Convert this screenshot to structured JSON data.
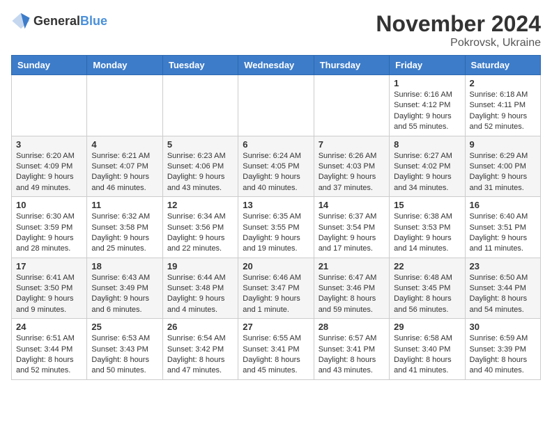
{
  "header": {
    "logo_general": "General",
    "logo_blue": "Blue",
    "month_title": "November 2024",
    "location": "Pokrovsk, Ukraine"
  },
  "weekdays": [
    "Sunday",
    "Monday",
    "Tuesday",
    "Wednesday",
    "Thursday",
    "Friday",
    "Saturday"
  ],
  "weeks": [
    [
      {
        "day": "",
        "sunrise": "",
        "sunset": "",
        "daylight": ""
      },
      {
        "day": "",
        "sunrise": "",
        "sunset": "",
        "daylight": ""
      },
      {
        "day": "",
        "sunrise": "",
        "sunset": "",
        "daylight": ""
      },
      {
        "day": "",
        "sunrise": "",
        "sunset": "",
        "daylight": ""
      },
      {
        "day": "",
        "sunrise": "",
        "sunset": "",
        "daylight": ""
      },
      {
        "day": "1",
        "sunrise": "Sunrise: 6:16 AM",
        "sunset": "Sunset: 4:12 PM",
        "daylight": "Daylight: 9 hours and 55 minutes."
      },
      {
        "day": "2",
        "sunrise": "Sunrise: 6:18 AM",
        "sunset": "Sunset: 4:11 PM",
        "daylight": "Daylight: 9 hours and 52 minutes."
      }
    ],
    [
      {
        "day": "3",
        "sunrise": "Sunrise: 6:20 AM",
        "sunset": "Sunset: 4:09 PM",
        "daylight": "Daylight: 9 hours and 49 minutes."
      },
      {
        "day": "4",
        "sunrise": "Sunrise: 6:21 AM",
        "sunset": "Sunset: 4:07 PM",
        "daylight": "Daylight: 9 hours and 46 minutes."
      },
      {
        "day": "5",
        "sunrise": "Sunrise: 6:23 AM",
        "sunset": "Sunset: 4:06 PM",
        "daylight": "Daylight: 9 hours and 43 minutes."
      },
      {
        "day": "6",
        "sunrise": "Sunrise: 6:24 AM",
        "sunset": "Sunset: 4:05 PM",
        "daylight": "Daylight: 9 hours and 40 minutes."
      },
      {
        "day": "7",
        "sunrise": "Sunrise: 6:26 AM",
        "sunset": "Sunset: 4:03 PM",
        "daylight": "Daylight: 9 hours and 37 minutes."
      },
      {
        "day": "8",
        "sunrise": "Sunrise: 6:27 AM",
        "sunset": "Sunset: 4:02 PM",
        "daylight": "Daylight: 9 hours and 34 minutes."
      },
      {
        "day": "9",
        "sunrise": "Sunrise: 6:29 AM",
        "sunset": "Sunset: 4:00 PM",
        "daylight": "Daylight: 9 hours and 31 minutes."
      }
    ],
    [
      {
        "day": "10",
        "sunrise": "Sunrise: 6:30 AM",
        "sunset": "Sunset: 3:59 PM",
        "daylight": "Daylight: 9 hours and 28 minutes."
      },
      {
        "day": "11",
        "sunrise": "Sunrise: 6:32 AM",
        "sunset": "Sunset: 3:58 PM",
        "daylight": "Daylight: 9 hours and 25 minutes."
      },
      {
        "day": "12",
        "sunrise": "Sunrise: 6:34 AM",
        "sunset": "Sunset: 3:56 PM",
        "daylight": "Daylight: 9 hours and 22 minutes."
      },
      {
        "day": "13",
        "sunrise": "Sunrise: 6:35 AM",
        "sunset": "Sunset: 3:55 PM",
        "daylight": "Daylight: 9 hours and 19 minutes."
      },
      {
        "day": "14",
        "sunrise": "Sunrise: 6:37 AM",
        "sunset": "Sunset: 3:54 PM",
        "daylight": "Daylight: 9 hours and 17 minutes."
      },
      {
        "day": "15",
        "sunrise": "Sunrise: 6:38 AM",
        "sunset": "Sunset: 3:53 PM",
        "daylight": "Daylight: 9 hours and 14 minutes."
      },
      {
        "day": "16",
        "sunrise": "Sunrise: 6:40 AM",
        "sunset": "Sunset: 3:51 PM",
        "daylight": "Daylight: 9 hours and 11 minutes."
      }
    ],
    [
      {
        "day": "17",
        "sunrise": "Sunrise: 6:41 AM",
        "sunset": "Sunset: 3:50 PM",
        "daylight": "Daylight: 9 hours and 9 minutes."
      },
      {
        "day": "18",
        "sunrise": "Sunrise: 6:43 AM",
        "sunset": "Sunset: 3:49 PM",
        "daylight": "Daylight: 9 hours and 6 minutes."
      },
      {
        "day": "19",
        "sunrise": "Sunrise: 6:44 AM",
        "sunset": "Sunset: 3:48 PM",
        "daylight": "Daylight: 9 hours and 4 minutes."
      },
      {
        "day": "20",
        "sunrise": "Sunrise: 6:46 AM",
        "sunset": "Sunset: 3:47 PM",
        "daylight": "Daylight: 9 hours and 1 minute."
      },
      {
        "day": "21",
        "sunrise": "Sunrise: 6:47 AM",
        "sunset": "Sunset: 3:46 PM",
        "daylight": "Daylight: 8 hours and 59 minutes."
      },
      {
        "day": "22",
        "sunrise": "Sunrise: 6:48 AM",
        "sunset": "Sunset: 3:45 PM",
        "daylight": "Daylight: 8 hours and 56 minutes."
      },
      {
        "day": "23",
        "sunrise": "Sunrise: 6:50 AM",
        "sunset": "Sunset: 3:44 PM",
        "daylight": "Daylight: 8 hours and 54 minutes."
      }
    ],
    [
      {
        "day": "24",
        "sunrise": "Sunrise: 6:51 AM",
        "sunset": "Sunset: 3:44 PM",
        "daylight": "Daylight: 8 hours and 52 minutes."
      },
      {
        "day": "25",
        "sunrise": "Sunrise: 6:53 AM",
        "sunset": "Sunset: 3:43 PM",
        "daylight": "Daylight: 8 hours and 50 minutes."
      },
      {
        "day": "26",
        "sunrise": "Sunrise: 6:54 AM",
        "sunset": "Sunset: 3:42 PM",
        "daylight": "Daylight: 8 hours and 47 minutes."
      },
      {
        "day": "27",
        "sunrise": "Sunrise: 6:55 AM",
        "sunset": "Sunset: 3:41 PM",
        "daylight": "Daylight: 8 hours and 45 minutes."
      },
      {
        "day": "28",
        "sunrise": "Sunrise: 6:57 AM",
        "sunset": "Sunset: 3:41 PM",
        "daylight": "Daylight: 8 hours and 43 minutes."
      },
      {
        "day": "29",
        "sunrise": "Sunrise: 6:58 AM",
        "sunset": "Sunset: 3:40 PM",
        "daylight": "Daylight: 8 hours and 41 minutes."
      },
      {
        "day": "30",
        "sunrise": "Sunrise: 6:59 AM",
        "sunset": "Sunset: 3:39 PM",
        "daylight": "Daylight: 8 hours and 40 minutes."
      }
    ]
  ]
}
